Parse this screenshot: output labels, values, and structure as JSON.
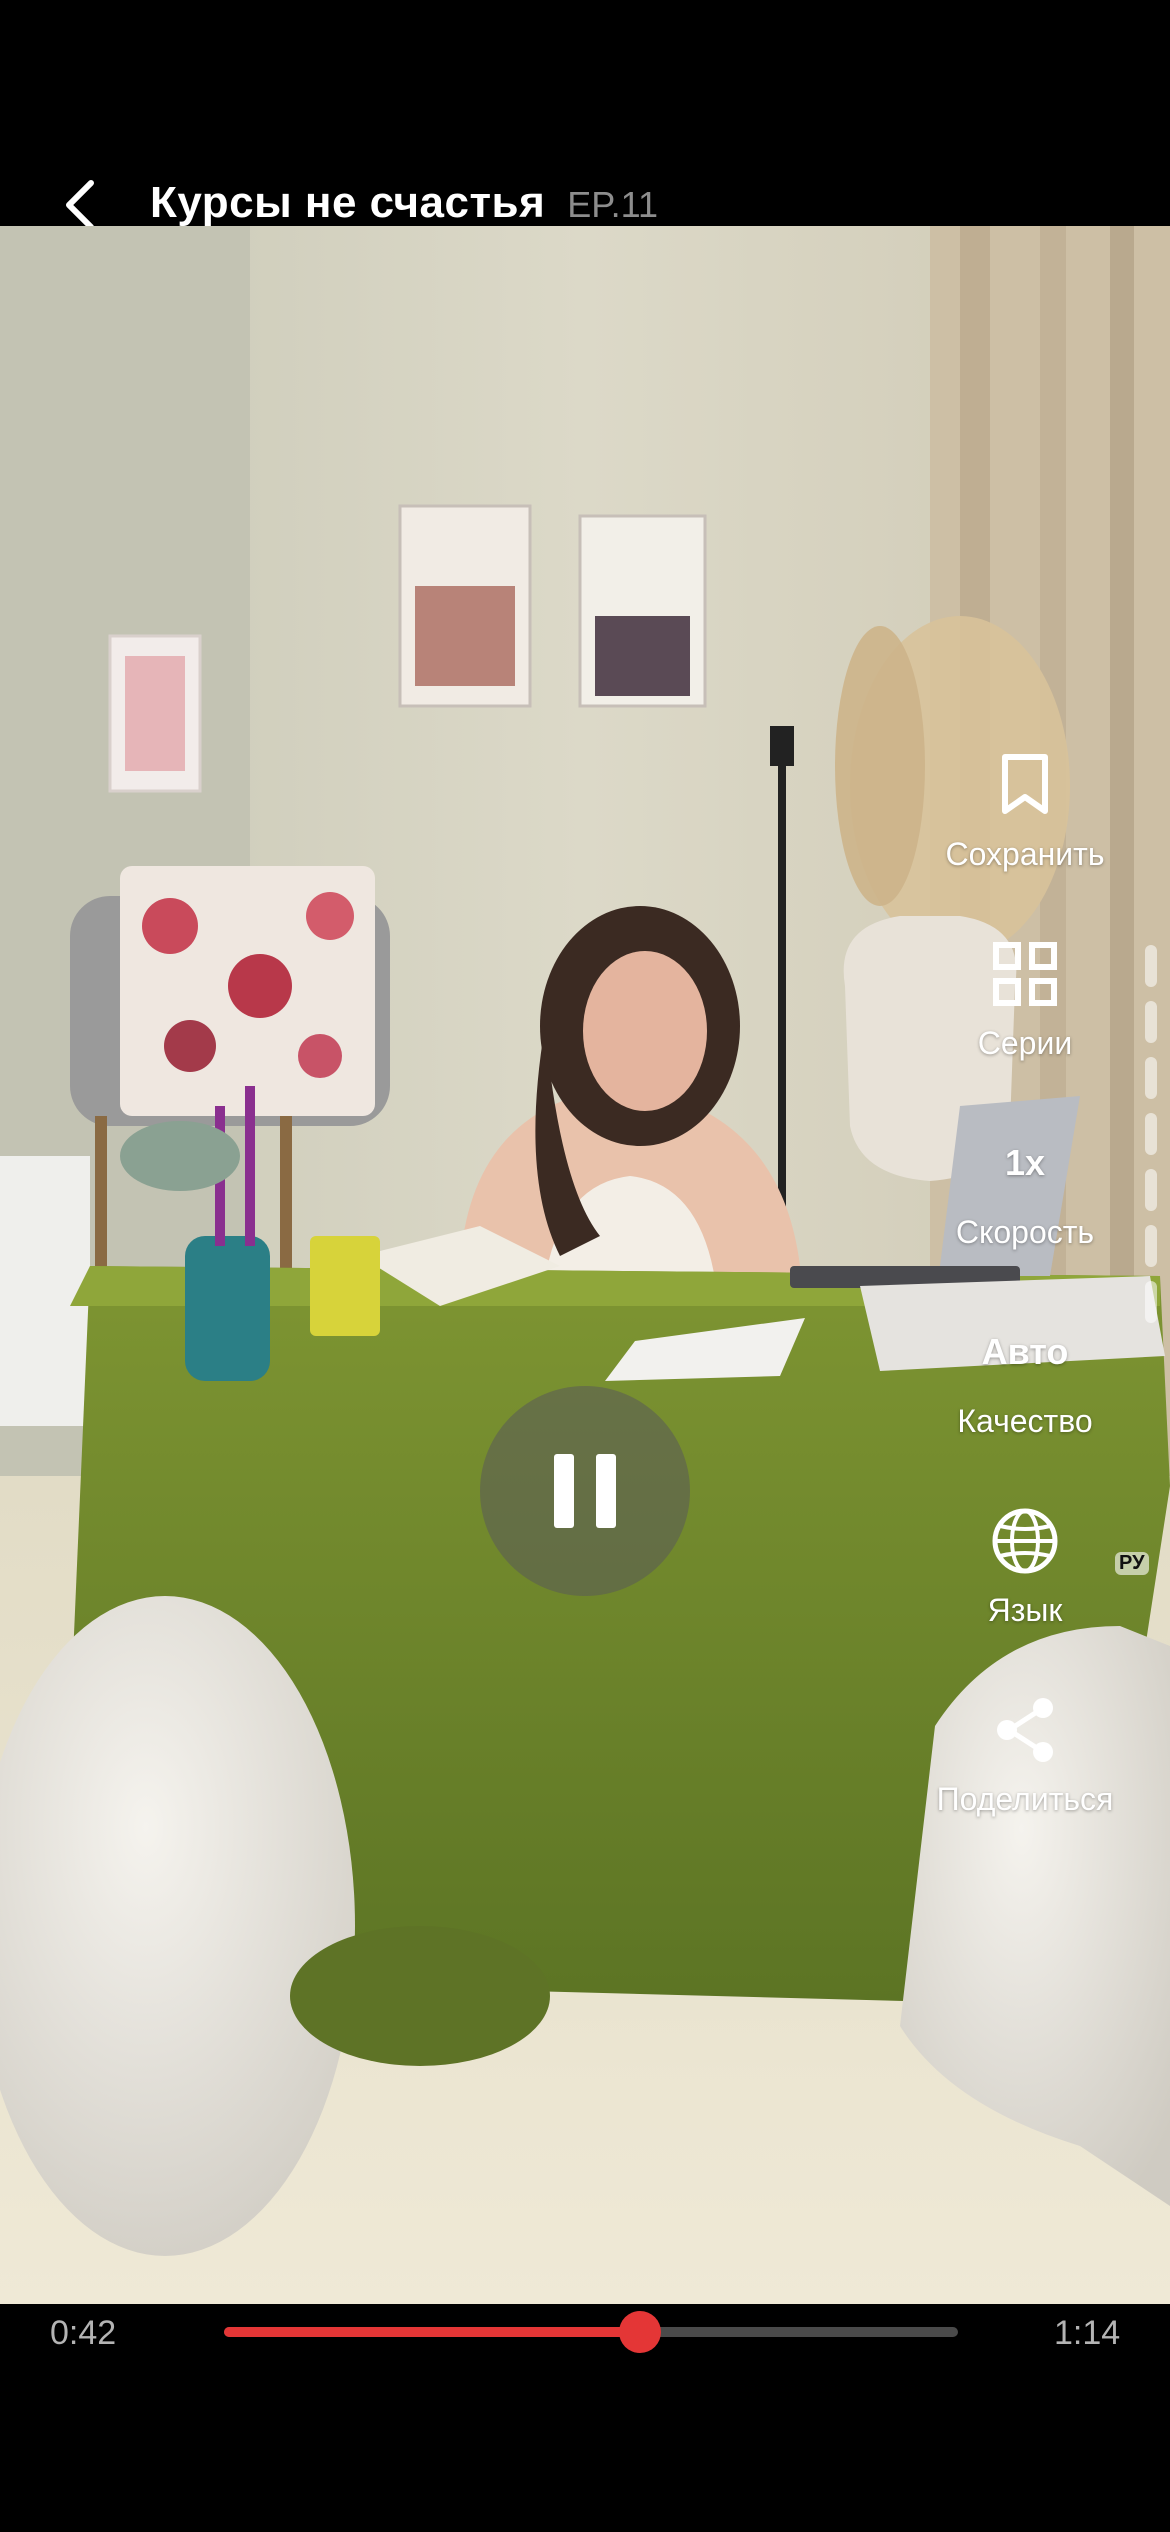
{
  "header": {
    "title": "Курсы не счастья",
    "episode": "EP.11"
  },
  "player": {
    "state": "playing",
    "current_time": "0:42",
    "duration": "1:14",
    "progress": 0.567
  },
  "actions": [
    {
      "id": "save",
      "label": "Сохранить",
      "icon": "bookmark-icon"
    },
    {
      "id": "episodes",
      "label": "Серии",
      "icon": "grid-icon"
    },
    {
      "id": "speed",
      "label": "Скорость",
      "value": "1x"
    },
    {
      "id": "quality",
      "label": "Качество",
      "value": "Авто"
    },
    {
      "id": "language",
      "label": "Язык",
      "icon": "globe-icon",
      "badge": "РУ"
    },
    {
      "id": "share",
      "label": "Поделиться",
      "icon": "share-icon"
    }
  ],
  "colors": {
    "accent": "#e43636",
    "background": "#000000"
  }
}
